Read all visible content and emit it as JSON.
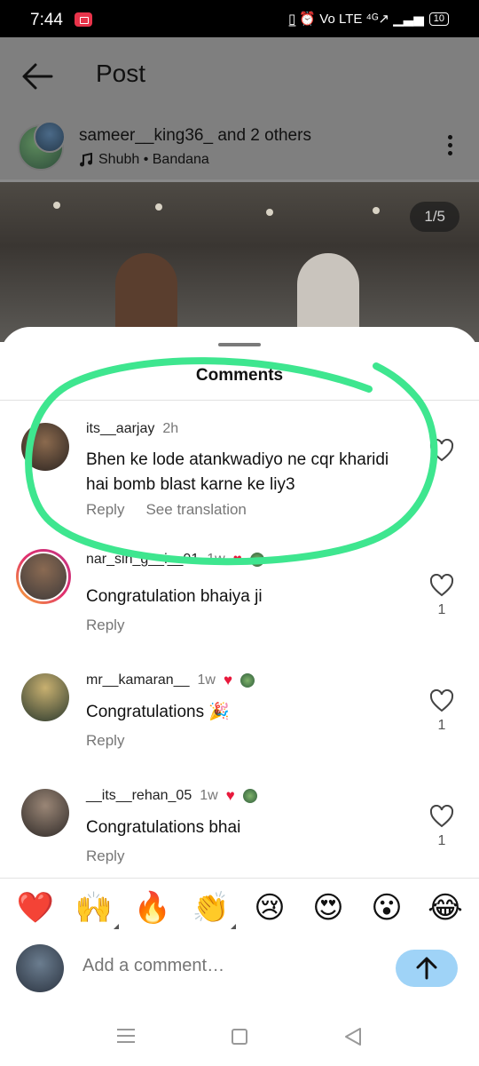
{
  "status_bar": {
    "time": "7:44",
    "icons": "▯̲ ⏰ Vo LTE ⁴ᴳ↗ ▁▃▅",
    "battery": "10"
  },
  "post": {
    "title": "Post",
    "owner": "sameer__king36_ and 2 others",
    "song": "Shubh • Bandana",
    "image_counter": "1/5"
  },
  "comments_sheet": {
    "title": "Comments",
    "comments": [
      {
        "username": "its__aarjay",
        "time": "2h",
        "badge": false,
        "text": "Bhen ke lode atankwadiyo ne cqr kharidi hai bomb blast karne ke liy3",
        "reply_label": "Reply",
        "translate_label": "See translation",
        "likes": ""
      },
      {
        "username": "nar_sin_g__i__01",
        "time": "1w",
        "badge": true,
        "text": "Congratulation bhaiya ji",
        "reply_label": "Reply",
        "translate_label": "",
        "likes": "1"
      },
      {
        "username": "mr__kamaran__",
        "time": "1w",
        "badge": true,
        "text": "Congratulations 🎉",
        "reply_label": "Reply",
        "translate_label": "",
        "likes": "1"
      },
      {
        "username": "__its__rehan_05",
        "time": "1w",
        "badge": true,
        "text": "Congratulations bhai",
        "reply_label": "Reply",
        "translate_label": "",
        "likes": "1"
      }
    ]
  },
  "quick_reactions": [
    "❤️",
    "🙌",
    "🔥",
    "👏",
    "😢",
    "😍",
    "😮",
    "😂"
  ],
  "composer": {
    "placeholder": "Add a comment…"
  },
  "colors": {
    "highlight": "#3ee68f",
    "send_button": "#9fd3f7",
    "like_red": "#e8193c"
  },
  "icons": [
    "back-arrow-icon",
    "music-note-icon",
    "more-options-icon",
    "heart-outline-icon",
    "heart-filled-icon",
    "send-arrow-icon",
    "menu-icon",
    "home-icon",
    "back-triangle-icon"
  ]
}
